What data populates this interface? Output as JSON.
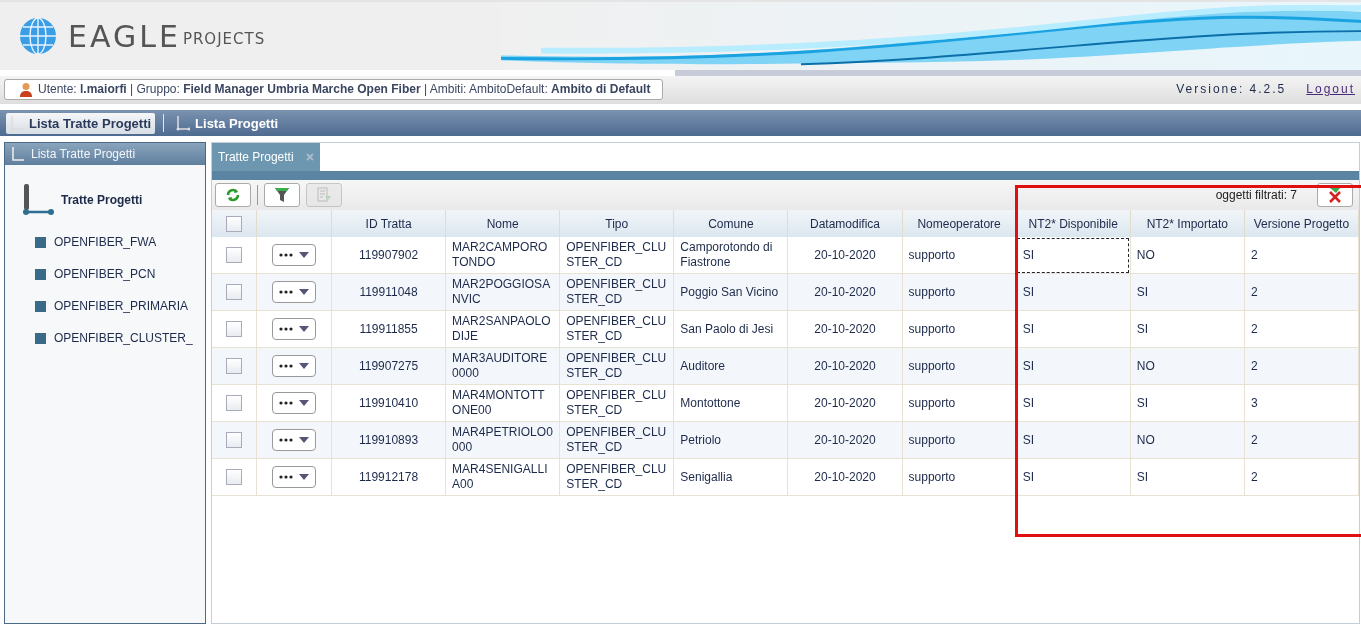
{
  "header": {
    "logo": {
      "main": "EAGLE",
      "sub": "PROJECTS"
    }
  },
  "user_bar": {
    "info": "Utente: **l.maiorfi** | Gruppo: **Field Manager Umbria Marche Open Fiber** | Ambiti: AmbitoDefault: **Ambito di Default**",
    "version": "Versione: 4.2.5",
    "logout": "Logout"
  },
  "nav_tabs": [
    {
      "label": "Lista Tratte Progetti",
      "selected": true
    },
    {
      "label": "Lista Progetti",
      "selected": false
    }
  ],
  "sidebar": {
    "title": "Lista Tratte Progetti",
    "tree": {
      "label": "Tratte Progetti",
      "children": [
        {
          "label": "OPENFIBER_FWA"
        },
        {
          "label": "OPENFIBER_PCN"
        },
        {
          "label": "OPENFIBER_PRIMARIA"
        },
        {
          "label": "OPENFIBER_CLUSTER_"
        }
      ]
    }
  },
  "content_tab": {
    "label": "Tratte Progetti"
  },
  "toolbar": {
    "buttons": [
      {
        "kind": "refresh",
        "disabled": false
      },
      {
        "kind": "filter",
        "disabled": false
      },
      {
        "kind": "export",
        "disabled": true
      }
    ],
    "filter_count": "oggetti filtrati: 7"
  },
  "table": {
    "select_all_checked": false,
    "columns": [
      "ID Tratta",
      "Nome",
      "Tipo",
      "Comune",
      "Datamodifica",
      "Nomeoperatore",
      "NT2* Disponibile",
      "NT2* Importato",
      "Versione Progetto"
    ],
    "rows": [
      {
        "checked": false,
        "focused": true,
        "cells": [
          "119907902",
          "MAR2CAMPOROTONDO",
          "OPENFIBER_CLUSTER_CD",
          "Camporotondo di Fiastrone",
          "20-10-2020",
          "supporto",
          "SI",
          "NO",
          "2"
        ]
      },
      {
        "checked": false,
        "focused": false,
        "cells": [
          "119911048",
          "MAR2POGGIOSANVIC",
          "OPENFIBER_CLUSTER_CD",
          "Poggio San Vicino",
          "20-10-2020",
          "supporto",
          "SI",
          "SI",
          "2"
        ]
      },
      {
        "checked": false,
        "focused": false,
        "cells": [
          "119911855",
          "MAR2SANPAOLODIJE",
          "OPENFIBER_CLUSTER_CD",
          "San Paolo di Jesi",
          "20-10-2020",
          "supporto",
          "SI",
          "SI",
          "2"
        ]
      },
      {
        "checked": false,
        "focused": false,
        "cells": [
          "119907275",
          "MAR3AUDITORE0000",
          "OPENFIBER_CLUSTER_CD",
          "Auditore",
          "20-10-2020",
          "supporto",
          "SI",
          "NO",
          "2"
        ]
      },
      {
        "checked": false,
        "focused": false,
        "cells": [
          "119910410",
          "MAR4MONTOTTONE00",
          "OPENFIBER_CLUSTER_CD",
          "Montottone",
          "20-10-2020",
          "supporto",
          "SI",
          "SI",
          "3"
        ]
      },
      {
        "checked": false,
        "focused": false,
        "cells": [
          "119910893",
          "MAR4PETRIOLO0000",
          "OPENFIBER_CLUSTER_CD",
          "Petriolo",
          "20-10-2020",
          "supporto",
          "SI",
          "NO",
          "2"
        ]
      },
      {
        "checked": false,
        "focused": false,
        "cells": [
          "119912178",
          "MAR4SENIGALLIA00",
          "OPENFIBER_CLUSTER_CD",
          "Senigallia",
          "20-10-2020",
          "supporto",
          "SI",
          "SI",
          "2"
        ]
      }
    ]
  }
}
